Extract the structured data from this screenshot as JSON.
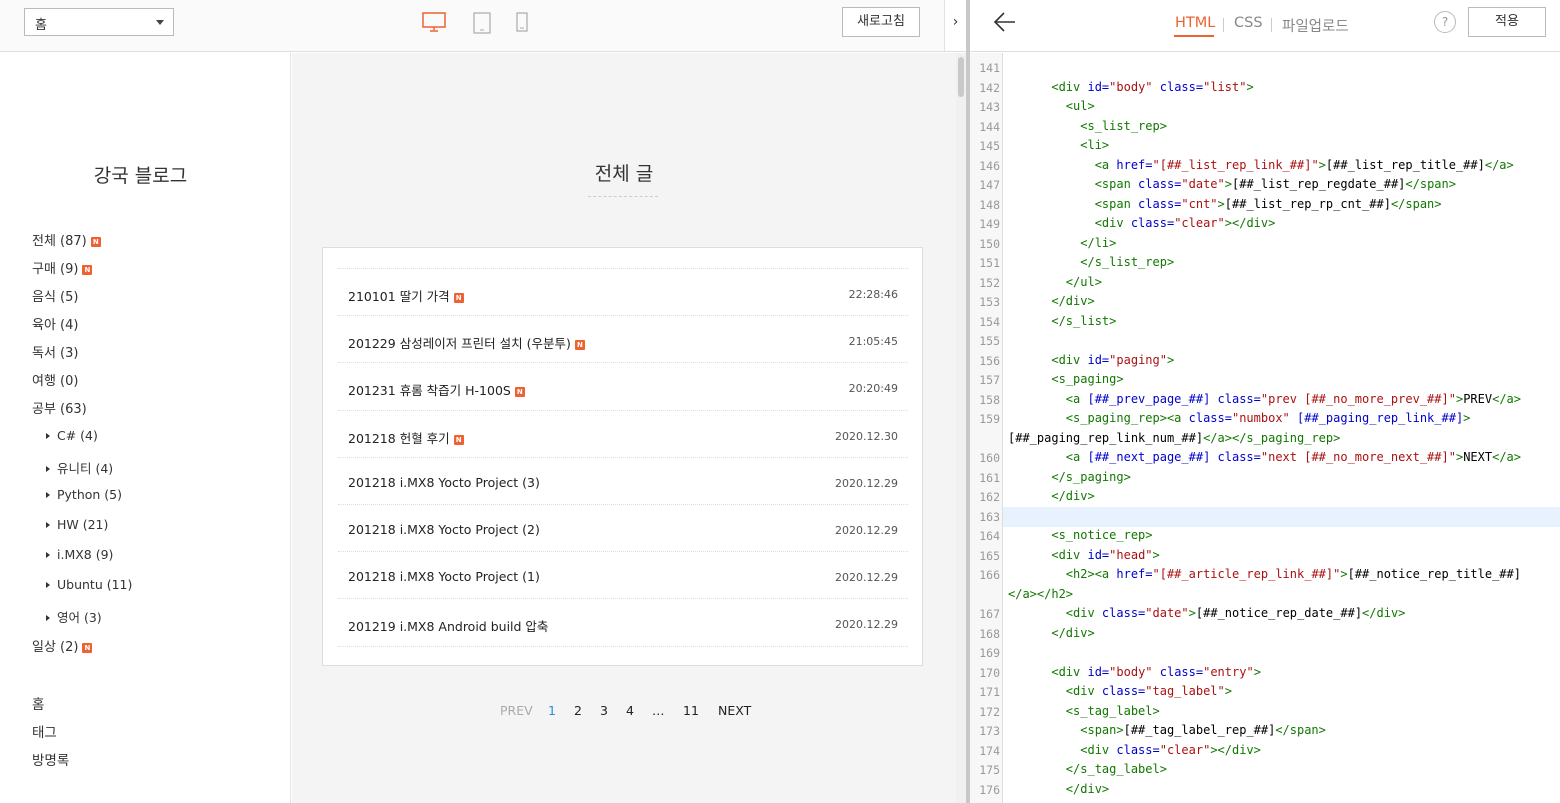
{
  "toolbar": {
    "page_select": "홈",
    "refresh_label": "새로고침",
    "collapse_label": "›"
  },
  "blog": {
    "title": "강국 블로그",
    "categories": [
      {
        "label": "전체 (87)",
        "new": true
      },
      {
        "label": "구매 (9)",
        "new": true
      },
      {
        "label": "음식 (5)",
        "new": false
      },
      {
        "label": "육아 (4)",
        "new": false
      },
      {
        "label": "독서 (3)",
        "new": false
      },
      {
        "label": "여행 (0)",
        "new": false
      },
      {
        "label": "공부 (63)",
        "new": false
      },
      {
        "label": "C# (4)",
        "new": false,
        "sub": true
      },
      {
        "label": "유니티 (4)",
        "new": false,
        "sub": true
      },
      {
        "label": "Python (5)",
        "new": false,
        "sub": true
      },
      {
        "label": "HW (21)",
        "new": false,
        "sub": true
      },
      {
        "label": "i.MX8 (9)",
        "new": false,
        "sub": true
      },
      {
        "label": "Ubuntu (11)",
        "new": false,
        "sub": true
      },
      {
        "label": "영어 (3)",
        "new": false,
        "sub": true
      },
      {
        "label": "일상 (2)",
        "new": true
      }
    ],
    "nav": [
      "홈",
      "태그",
      "방명록"
    ],
    "new_badge": "N",
    "main_title": "전체 글",
    "posts": [
      {
        "title": "210101 딸기 가격",
        "date": "22:28:46",
        "new": true
      },
      {
        "title": "201229 삼성레이저 프린터 설치 (우분투)",
        "date": "21:05:45",
        "new": true
      },
      {
        "title": "201231 휴롬 착즙기 H-100S",
        "date": "20:20:49",
        "new": true
      },
      {
        "title": "201218 헌혈 후기",
        "date": "2020.12.30",
        "new": true
      },
      {
        "title": "201218 i.MX8 Yocto Project (3)",
        "date": "2020.12.29",
        "new": false
      },
      {
        "title": "201218 i.MX8 Yocto Project (2)",
        "date": "2020.12.29",
        "new": false
      },
      {
        "title": "201218 i.MX8 Yocto Project (1)",
        "date": "2020.12.29",
        "new": false
      },
      {
        "title": "201219 i.MX8 Android build 압축",
        "date": "2020.12.29",
        "new": false
      }
    ],
    "paging": {
      "prev": "PREV",
      "pages": [
        "1",
        "2",
        "3",
        "4",
        "…",
        "11"
      ],
      "current": "1",
      "next": "NEXT"
    }
  },
  "editor": {
    "tabs": [
      "HTML",
      "CSS",
      "파일업로드"
    ],
    "active_tab": "HTML",
    "help_label": "?",
    "apply_label": "적용",
    "highlighted_line": "163",
    "code_lines": [
      {
        "n": "141",
        "parts": []
      },
      {
        "n": "142",
        "parts": [
          [
            "t",
            "      <div "
          ],
          [
            "a",
            "id="
          ],
          [
            "s",
            "\"body\""
          ],
          [
            "a",
            " class="
          ],
          [
            "s",
            "\"list\""
          ],
          [
            "t",
            ">"
          ]
        ]
      },
      {
        "n": "143",
        "parts": [
          [
            "t",
            "        <ul>"
          ]
        ]
      },
      {
        "n": "144",
        "parts": [
          [
            "t",
            "          <s_list_rep>"
          ]
        ]
      },
      {
        "n": "145",
        "parts": [
          [
            "t",
            "          <li>"
          ]
        ]
      },
      {
        "n": "146",
        "parts": [
          [
            "t",
            "            <a "
          ],
          [
            "a",
            "href="
          ],
          [
            "s",
            "\"[##_list_rep_link_##]\""
          ],
          [
            "t",
            ">"
          ],
          [
            "x",
            "[##_list_rep_title_##]"
          ],
          [
            "t",
            "</a>"
          ]
        ]
      },
      {
        "n": "147",
        "parts": [
          [
            "t",
            "            <span "
          ],
          [
            "a",
            "class="
          ],
          [
            "s",
            "\"date\""
          ],
          [
            "t",
            ">"
          ],
          [
            "x",
            "[##_list_rep_regdate_##]"
          ],
          [
            "t",
            "</span>"
          ]
        ]
      },
      {
        "n": "148",
        "parts": [
          [
            "t",
            "            <span "
          ],
          [
            "a",
            "class="
          ],
          [
            "s",
            "\"cnt\""
          ],
          [
            "t",
            ">"
          ],
          [
            "x",
            "[##_list_rep_rp_cnt_##]"
          ],
          [
            "t",
            "</span>"
          ]
        ]
      },
      {
        "n": "149",
        "parts": [
          [
            "t",
            "            <div "
          ],
          [
            "a",
            "class="
          ],
          [
            "s",
            "\"clear\""
          ],
          [
            "t",
            "></div>"
          ]
        ]
      },
      {
        "n": "150",
        "parts": [
          [
            "t",
            "          </li>"
          ]
        ]
      },
      {
        "n": "151",
        "parts": [
          [
            "t",
            "          </s_list_rep>"
          ]
        ]
      },
      {
        "n": "152",
        "parts": [
          [
            "t",
            "        </ul>"
          ]
        ]
      },
      {
        "n": "153",
        "parts": [
          [
            "t",
            "      </div>"
          ]
        ]
      },
      {
        "n": "154",
        "parts": [
          [
            "t",
            "      </s_list>"
          ]
        ]
      },
      {
        "n": "155",
        "parts": []
      },
      {
        "n": "156",
        "parts": [
          [
            "t",
            "      <div "
          ],
          [
            "a",
            "id="
          ],
          [
            "s",
            "\"paging\""
          ],
          [
            "t",
            ">"
          ]
        ]
      },
      {
        "n": "157",
        "parts": [
          [
            "t",
            "      <s_paging>"
          ]
        ]
      },
      {
        "n": "158",
        "parts": [
          [
            "t",
            "        <a "
          ],
          [
            "a",
            "[##_prev_page_##] class="
          ],
          [
            "s",
            "\"prev [##_no_more_prev_##]\""
          ],
          [
            "t",
            ">"
          ],
          [
            "x",
            "PREV"
          ],
          [
            "t",
            "</a>"
          ]
        ]
      },
      {
        "n": "159",
        "parts": [
          [
            "t",
            "        <s_paging_rep><a "
          ],
          [
            "a",
            "class="
          ],
          [
            "s",
            "\"numbox\""
          ],
          [
            "a",
            " [##_paging_rep_link_##]"
          ],
          [
            "t",
            ">"
          ]
        ]
      },
      {
        "n": "",
        "parts": [
          [
            "x",
            "[##_paging_rep_link_num_##]"
          ],
          [
            "t",
            "</a></s_paging_rep>"
          ]
        ]
      },
      {
        "n": "160",
        "parts": [
          [
            "t",
            "        <a "
          ],
          [
            "a",
            "[##_next_page_##] class="
          ],
          [
            "s",
            "\"next [##_no_more_next_##]\""
          ],
          [
            "t",
            ">"
          ],
          [
            "x",
            "NEXT"
          ],
          [
            "t",
            "</a>"
          ]
        ]
      },
      {
        "n": "161",
        "parts": [
          [
            "t",
            "      </s_paging>"
          ]
        ]
      },
      {
        "n": "162",
        "parts": [
          [
            "t",
            "      </div>"
          ]
        ]
      },
      {
        "n": "163",
        "parts": []
      },
      {
        "n": "164",
        "parts": [
          [
            "t",
            "      <s_notice_rep>"
          ]
        ]
      },
      {
        "n": "165",
        "parts": [
          [
            "t",
            "      <div "
          ],
          [
            "a",
            "id="
          ],
          [
            "s",
            "\"head\""
          ],
          [
            "t",
            ">"
          ]
        ]
      },
      {
        "n": "166",
        "parts": [
          [
            "t",
            "        <h2><a "
          ],
          [
            "a",
            "href="
          ],
          [
            "s",
            "\"[##_article_rep_link_##]\""
          ],
          [
            "t",
            ">"
          ],
          [
            "x",
            "[##_notice_rep_title_##]"
          ]
        ]
      },
      {
        "n": "",
        "parts": [
          [
            "t",
            "</a></h2>"
          ]
        ]
      },
      {
        "n": "167",
        "parts": [
          [
            "t",
            "        <div "
          ],
          [
            "a",
            "class="
          ],
          [
            "s",
            "\"date\""
          ],
          [
            "t",
            ">"
          ],
          [
            "x",
            "[##_notice_rep_date_##]"
          ],
          [
            "t",
            "</div>"
          ]
        ]
      },
      {
        "n": "168",
        "parts": [
          [
            "t",
            "      </div>"
          ]
        ]
      },
      {
        "n": "169",
        "parts": []
      },
      {
        "n": "170",
        "parts": [
          [
            "t",
            "      <div "
          ],
          [
            "a",
            "id="
          ],
          [
            "s",
            "\"body\""
          ],
          [
            "a",
            " class="
          ],
          [
            "s",
            "\"entry\""
          ],
          [
            "t",
            ">"
          ]
        ]
      },
      {
        "n": "171",
        "parts": [
          [
            "t",
            "        <div "
          ],
          [
            "a",
            "class="
          ],
          [
            "s",
            "\"tag_label\""
          ],
          [
            "t",
            ">"
          ]
        ]
      },
      {
        "n": "172",
        "parts": [
          [
            "t",
            "        <s_tag_label>"
          ]
        ]
      },
      {
        "n": "173",
        "parts": [
          [
            "t",
            "          <span>"
          ],
          [
            "x",
            "[##_tag_label_rep_##]"
          ],
          [
            "t",
            "</span>"
          ]
        ]
      },
      {
        "n": "174",
        "parts": [
          [
            "t",
            "          <div "
          ],
          [
            "a",
            "class="
          ],
          [
            "s",
            "\"clear\""
          ],
          [
            "t",
            "></div>"
          ]
        ]
      },
      {
        "n": "175",
        "parts": [
          [
            "t",
            "        </s_tag_label>"
          ]
        ]
      },
      {
        "n": "176",
        "parts": [
          [
            "t",
            "        </div>"
          ]
        ]
      }
    ]
  },
  "colors": {
    "accent": "#ee6231",
    "current_page": "#2a8fd6",
    "code_tag": "#117700",
    "code_attr": "#0000cc",
    "code_string": "#aa1111"
  },
  "icons": [
    "chevron-down-icon",
    "desktop-icon",
    "tablet-icon",
    "mobile-icon",
    "chevron-right-icon",
    "back-arrow-icon",
    "help-icon",
    "triangle-right-icon",
    "new-badge-icon"
  ]
}
